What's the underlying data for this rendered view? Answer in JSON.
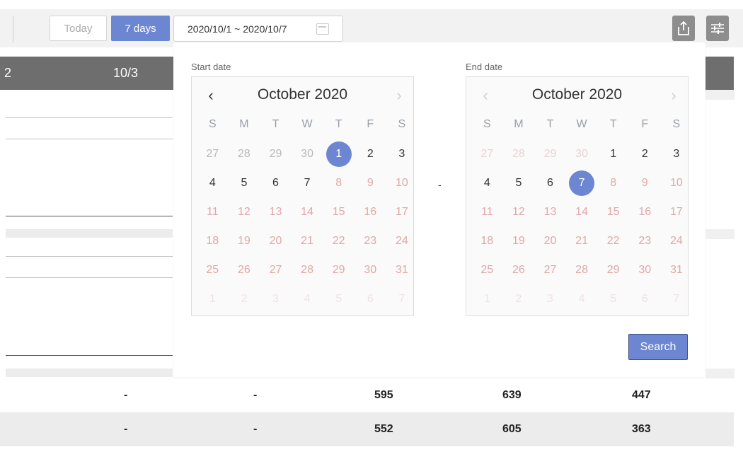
{
  "toolbar": {
    "today_label": "Today",
    "seven_days_label": "7 days",
    "date_range_value": "2020/10/1 ~ 2020/10/7",
    "export_icon": "export-icon",
    "settings_icon": "sliders-icon"
  },
  "report": {
    "header_cells": [
      "2",
      "10/3"
    ],
    "rows": [
      {
        "cells": [
          "-",
          "-",
          "595",
          "639",
          "447"
        ]
      },
      {
        "cells": [
          "-",
          "-",
          "552",
          "605",
          "363"
        ]
      }
    ]
  },
  "picker": {
    "start_label": "Start date",
    "end_label": "End date",
    "separator": "-",
    "search_label": "Search",
    "weekdays": [
      "S",
      "M",
      "T",
      "W",
      "T",
      "F",
      "S"
    ],
    "start": {
      "title": "October 2020",
      "prev_icon": "chevron-left-icon",
      "next_icon": "chevron-right-icon",
      "days": [
        {
          "n": "27",
          "s": "prevm"
        },
        {
          "n": "28",
          "s": "prevm"
        },
        {
          "n": "29",
          "s": "prevm"
        },
        {
          "n": "30",
          "s": "prevm"
        },
        {
          "n": "1",
          "s": "sel"
        },
        {
          "n": "2",
          "s": "normal"
        },
        {
          "n": "3",
          "s": "normal"
        },
        {
          "n": "4",
          "s": "normal"
        },
        {
          "n": "5",
          "s": "normal"
        },
        {
          "n": "6",
          "s": "normal"
        },
        {
          "n": "7",
          "s": "normal"
        },
        {
          "n": "8",
          "s": "dis"
        },
        {
          "n": "9",
          "s": "dis"
        },
        {
          "n": "10",
          "s": "dis"
        },
        {
          "n": "11",
          "s": "dis"
        },
        {
          "n": "12",
          "s": "dis"
        },
        {
          "n": "13",
          "s": "dis"
        },
        {
          "n": "14",
          "s": "dis"
        },
        {
          "n": "15",
          "s": "dis"
        },
        {
          "n": "16",
          "s": "dis"
        },
        {
          "n": "17",
          "s": "dis"
        },
        {
          "n": "18",
          "s": "dis"
        },
        {
          "n": "19",
          "s": "dis"
        },
        {
          "n": "20",
          "s": "dis"
        },
        {
          "n": "21",
          "s": "dis"
        },
        {
          "n": "22",
          "s": "dis"
        },
        {
          "n": "23",
          "s": "dis"
        },
        {
          "n": "24",
          "s": "dis"
        },
        {
          "n": "25",
          "s": "dis"
        },
        {
          "n": "26",
          "s": "dis"
        },
        {
          "n": "27",
          "s": "dis"
        },
        {
          "n": "28",
          "s": "dis"
        },
        {
          "n": "29",
          "s": "dis"
        },
        {
          "n": "30",
          "s": "dis"
        },
        {
          "n": "31",
          "s": "dis"
        },
        {
          "n": "1",
          "s": "nextm"
        },
        {
          "n": "2",
          "s": "nextm"
        },
        {
          "n": "3",
          "s": "nextm"
        },
        {
          "n": "4",
          "s": "nextm"
        },
        {
          "n": "5",
          "s": "nextm"
        },
        {
          "n": "6",
          "s": "nextm"
        },
        {
          "n": "7",
          "s": "nextm"
        }
      ]
    },
    "end": {
      "title": "October 2020",
      "prev_icon": "chevron-left-icon",
      "next_icon": "chevron-right-icon",
      "days": [
        {
          "n": "27",
          "s": "prevm-faded"
        },
        {
          "n": "28",
          "s": "prevm-faded"
        },
        {
          "n": "29",
          "s": "prevm-faded"
        },
        {
          "n": "30",
          "s": "prevm-faded"
        },
        {
          "n": "1",
          "s": "normal"
        },
        {
          "n": "2",
          "s": "normal"
        },
        {
          "n": "3",
          "s": "normal"
        },
        {
          "n": "4",
          "s": "normal"
        },
        {
          "n": "5",
          "s": "normal"
        },
        {
          "n": "6",
          "s": "normal"
        },
        {
          "n": "7",
          "s": "sel"
        },
        {
          "n": "8",
          "s": "dis"
        },
        {
          "n": "9",
          "s": "dis"
        },
        {
          "n": "10",
          "s": "dis"
        },
        {
          "n": "11",
          "s": "dis"
        },
        {
          "n": "12",
          "s": "dis"
        },
        {
          "n": "13",
          "s": "dis"
        },
        {
          "n": "14",
          "s": "dis"
        },
        {
          "n": "15",
          "s": "dis"
        },
        {
          "n": "16",
          "s": "dis"
        },
        {
          "n": "17",
          "s": "dis"
        },
        {
          "n": "18",
          "s": "dis"
        },
        {
          "n": "19",
          "s": "dis"
        },
        {
          "n": "20",
          "s": "dis"
        },
        {
          "n": "21",
          "s": "dis"
        },
        {
          "n": "22",
          "s": "dis"
        },
        {
          "n": "23",
          "s": "dis"
        },
        {
          "n": "24",
          "s": "dis"
        },
        {
          "n": "25",
          "s": "dis"
        },
        {
          "n": "26",
          "s": "dis"
        },
        {
          "n": "27",
          "s": "dis"
        },
        {
          "n": "28",
          "s": "dis"
        },
        {
          "n": "29",
          "s": "dis"
        },
        {
          "n": "30",
          "s": "dis"
        },
        {
          "n": "31",
          "s": "dis"
        },
        {
          "n": "1",
          "s": "nextm"
        },
        {
          "n": "2",
          "s": "nextm"
        },
        {
          "n": "3",
          "s": "nextm"
        },
        {
          "n": "4",
          "s": "nextm"
        },
        {
          "n": "5",
          "s": "nextm"
        },
        {
          "n": "6",
          "s": "nextm"
        },
        {
          "n": "7",
          "s": "nextm"
        }
      ]
    }
  },
  "colors": {
    "accent": "#6c86d1",
    "header_gray": "#6e6e6e",
    "disabled_day": "#e0a7a7"
  }
}
